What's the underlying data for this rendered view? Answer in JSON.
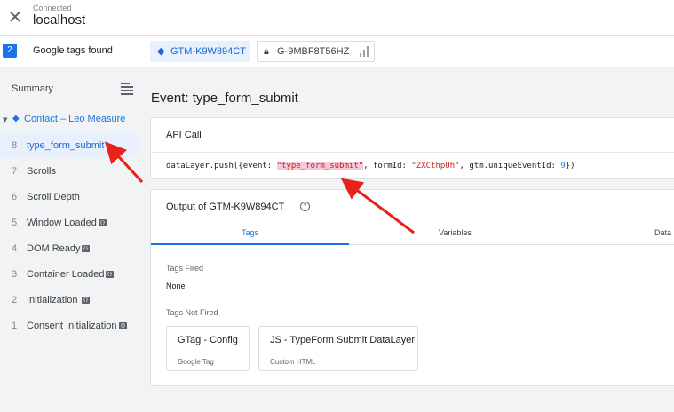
{
  "topbar": {
    "connection_status": "Connected",
    "host": "localhost",
    "close_glyph": "✕"
  },
  "tags_bar": {
    "count": "2",
    "found_label": "Google tags found",
    "chips": [
      {
        "label": "GTM-K9W894CT",
        "icon": "gtm-diamond-icon",
        "selected": true
      },
      {
        "label": "G-9MBF8T56HZ",
        "icon": "lock-icon",
        "selected": false
      }
    ]
  },
  "sidebar": {
    "summary_label": "Summary",
    "group_label": "Contact – Leo Measure",
    "events": [
      {
        "num": "8",
        "name": "type_form_submit",
        "selected": true,
        "api": false
      },
      {
        "num": "7",
        "name": "Scrolls",
        "selected": false,
        "api": false
      },
      {
        "num": "6",
        "name": "Scroll Depth",
        "selected": false,
        "api": false
      },
      {
        "num": "5",
        "name": "Window Loaded",
        "selected": false,
        "api": true
      },
      {
        "num": "4",
        "name": "DOM Ready",
        "selected": false,
        "api": true
      },
      {
        "num": "3",
        "name": "Container Loaded",
        "selected": false,
        "api": true
      },
      {
        "num": "2",
        "name": "Initialization",
        "selected": false,
        "api": true
      },
      {
        "num": "1",
        "name": "Consent Initialization",
        "selected": false,
        "api": true
      }
    ]
  },
  "main": {
    "title": "Event: type_form_submit",
    "api_call": {
      "header": "API Call",
      "code_prefix": "dataLayer.push({event: ",
      "code_event": "\"type_form_submit\"",
      "code_middle": ", formId: ",
      "code_form_id": "\"ZXCthpUh\"",
      "code_after": ", gtm.uniqueEventId: ",
      "code_unique_id": "9",
      "code_suffix": "})"
    },
    "output": {
      "title": "Output of GTM-K9W894CT",
      "tabs": [
        {
          "label": "Tags",
          "active": true
        },
        {
          "label": "Variables",
          "active": false
        },
        {
          "label": "Data",
          "active": false
        }
      ],
      "tags_fired_label": "Tags Fired",
      "tags_fired_value": "None",
      "tags_not_fired_label": "Tags Not Fired",
      "tags_not_fired": [
        {
          "name": "GTag - Config",
          "type": "Google Tag"
        },
        {
          "name": "JS - TypeForm Submit DataLayer",
          "type": "Custom HTML"
        }
      ]
    }
  },
  "colors": {
    "accent": "#1a73e8",
    "annotation_arrow": "#e8221b",
    "selection": "#e8f0fe"
  }
}
